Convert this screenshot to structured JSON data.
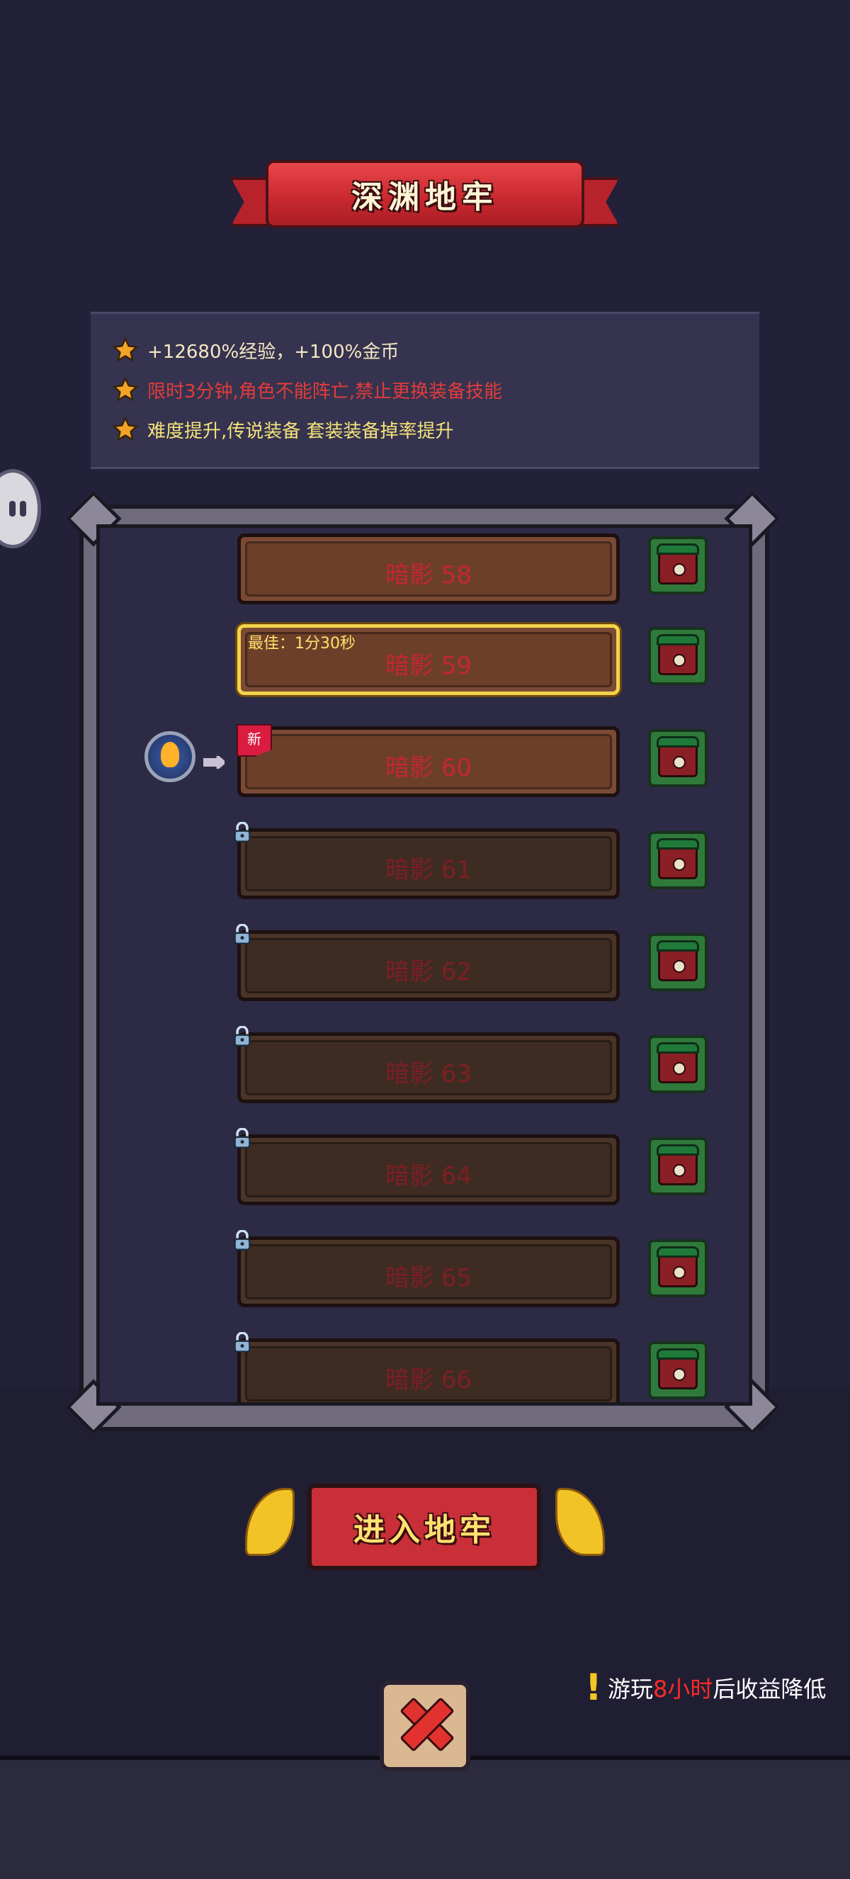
{
  "header": {
    "title": "深渊地牢"
  },
  "info": {
    "rows": [
      {
        "icon": "star-icon",
        "text": "+12680%经验，+100%金币",
        "color": "#f6e7c3"
      },
      {
        "icon": "star-icon",
        "text": "限时3分钟,角色不能阵亡,禁止更换装备技能",
        "color": "#e23b3b"
      },
      {
        "icon": "star-icon",
        "text": "难度提升,传说装备 套装装备掉率提升",
        "color": "#f4e27a"
      }
    ]
  },
  "levels": [
    {
      "name": "暗影 58",
      "locked": false
    },
    {
      "name": "暗影 59",
      "locked": false,
      "selected": true,
      "best": "最佳：1分30秒"
    },
    {
      "name": "暗影 60",
      "locked": false,
      "new_tag": "新",
      "current": true
    },
    {
      "name": "暗影 61",
      "locked": true
    },
    {
      "name": "暗影 62",
      "locked": true
    },
    {
      "name": "暗影 63",
      "locked": true
    },
    {
      "name": "暗影 64",
      "locked": true
    },
    {
      "name": "暗影 65",
      "locked": true
    },
    {
      "name": "暗影 66",
      "locked": true
    }
  ],
  "enter_button": {
    "label": "进入地牢"
  },
  "notice": {
    "prefix": "游玩",
    "highlight": "8小时",
    "suffix": "后收益降低"
  },
  "icons": {
    "close": "close-icon",
    "lock": "lock-icon",
    "chest": "chest-icon",
    "player": "player-marker-icon"
  },
  "colors": {
    "accent_red": "#c92f38",
    "gold": "#f4d34b",
    "locked_text": "#7e1e24"
  }
}
